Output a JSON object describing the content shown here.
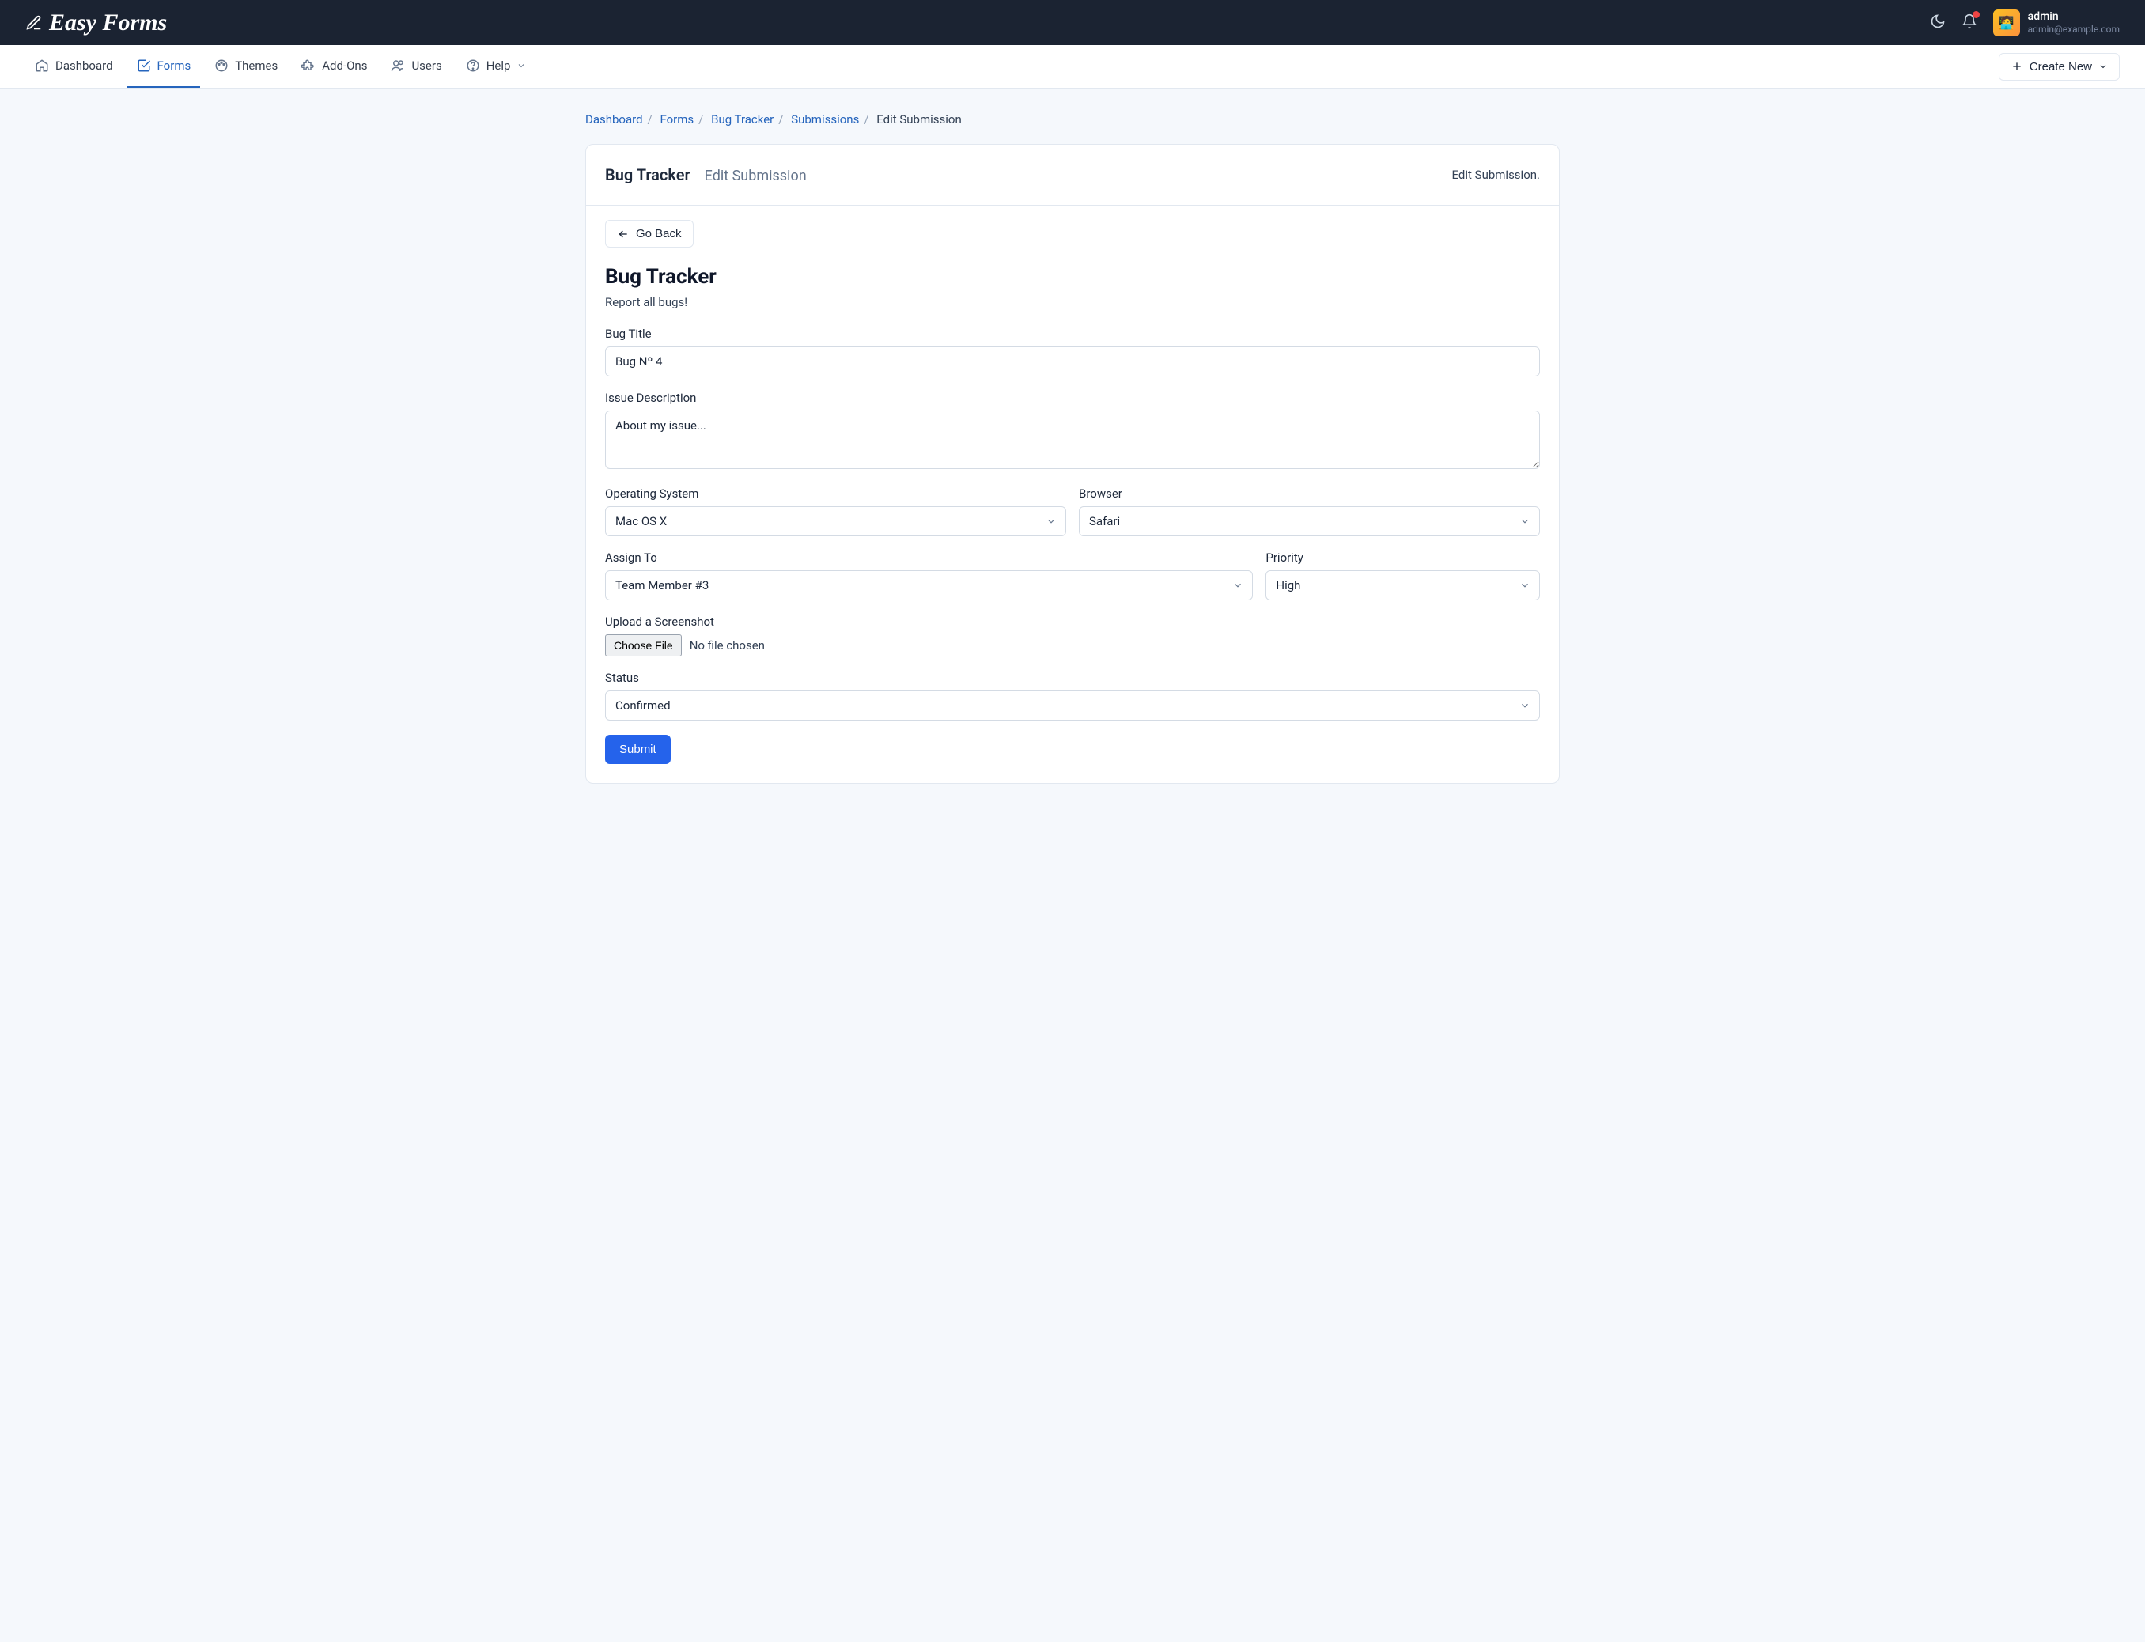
{
  "brand": "Easy Forms",
  "user": {
    "name": "admin",
    "email": "admin@example.com"
  },
  "nav": {
    "items": [
      {
        "label": "Dashboard",
        "active": false
      },
      {
        "label": "Forms",
        "active": true
      },
      {
        "label": "Themes",
        "active": false
      },
      {
        "label": "Add-Ons",
        "active": false
      },
      {
        "label": "Users",
        "active": false
      },
      {
        "label": "Help",
        "active": false,
        "dropdown": true
      }
    ],
    "create": "Create New"
  },
  "breadcrumbs": {
    "items": [
      "Dashboard",
      "Forms",
      "Bug Tracker",
      "Submissions"
    ],
    "current": "Edit Submission"
  },
  "cardHead": {
    "title": "Bug Tracker",
    "subtitle": "Edit Submission",
    "meta": "Edit Submission."
  },
  "back": "Go Back",
  "form": {
    "title": "Bug Tracker",
    "desc": "Report all bugs!",
    "fields": {
      "bugTitle": {
        "label": "Bug Title",
        "value": "Bug Nº 4"
      },
      "issueDesc": {
        "label": "Issue Description",
        "value": "About my issue..."
      },
      "os": {
        "label": "Operating System",
        "value": "Mac OS X"
      },
      "browser": {
        "label": "Browser",
        "value": "Safari"
      },
      "assign": {
        "label": "Assign To",
        "value": "Team Member #3"
      },
      "priority": {
        "label": "Priority",
        "value": "High"
      },
      "screenshot": {
        "label": "Upload a Screenshot",
        "button": "Choose File",
        "status": "No file chosen"
      },
      "status": {
        "label": "Status",
        "value": "Confirmed"
      }
    },
    "submit": "Submit"
  }
}
